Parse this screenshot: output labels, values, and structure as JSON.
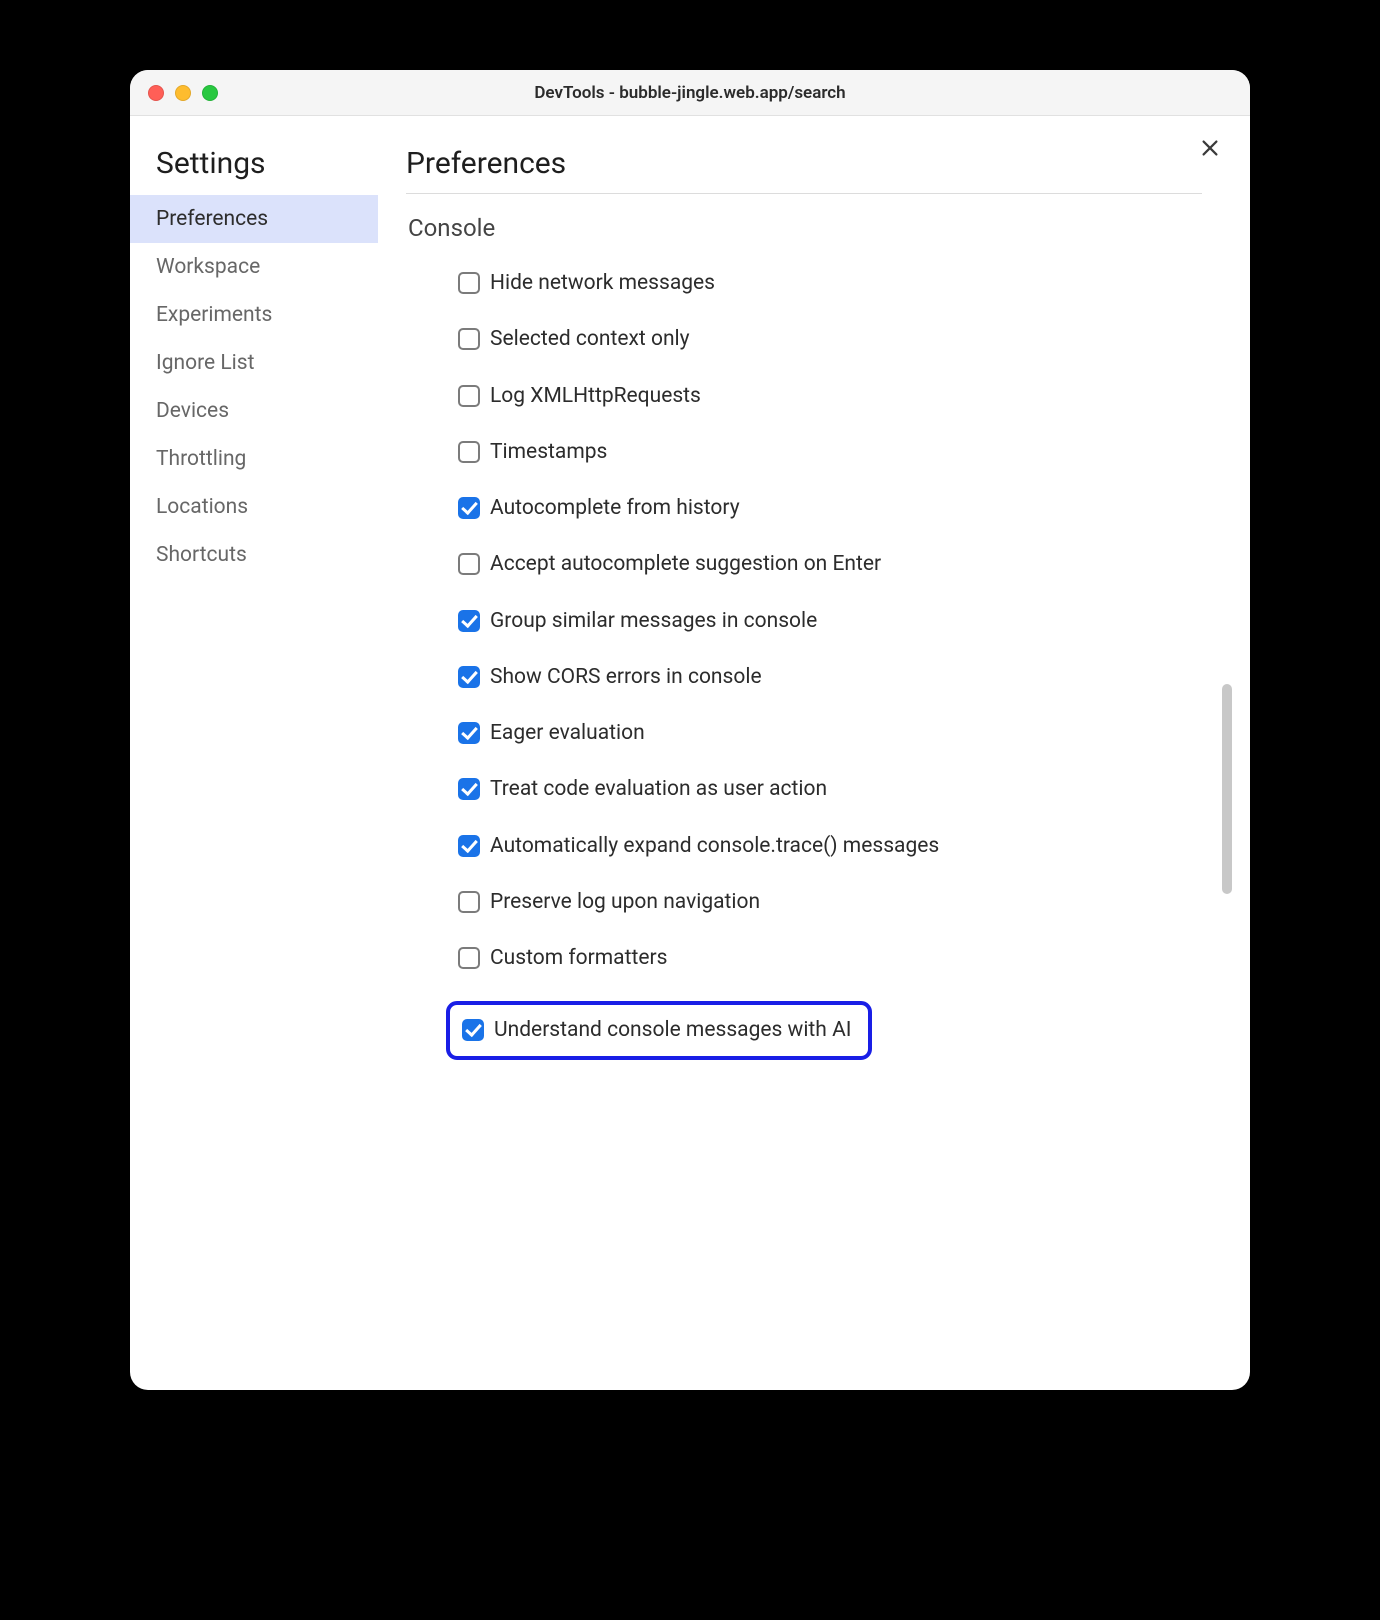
{
  "window_title": "DevTools - bubble-jingle.web.app/search",
  "sidebar": {
    "title": "Settings",
    "items": [
      {
        "label": "Preferences",
        "active": true
      },
      {
        "label": "Workspace",
        "active": false
      },
      {
        "label": "Experiments",
        "active": false
      },
      {
        "label": "Ignore List",
        "active": false
      },
      {
        "label": "Devices",
        "active": false
      },
      {
        "label": "Throttling",
        "active": false
      },
      {
        "label": "Locations",
        "active": false
      },
      {
        "label": "Shortcuts",
        "active": false
      }
    ]
  },
  "main": {
    "title": "Preferences",
    "section": "Console",
    "options": [
      {
        "label": "Hide network messages",
        "checked": false
      },
      {
        "label": "Selected context only",
        "checked": false
      },
      {
        "label": "Log XMLHttpRequests",
        "checked": false
      },
      {
        "label": "Timestamps",
        "checked": false
      },
      {
        "label": "Autocomplete from history",
        "checked": true
      },
      {
        "label": "Accept autocomplete suggestion on Enter",
        "checked": false
      },
      {
        "label": "Group similar messages in console",
        "checked": true
      },
      {
        "label": "Show CORS errors in console",
        "checked": true
      },
      {
        "label": "Eager evaluation",
        "checked": true
      },
      {
        "label": "Treat code evaluation as user action",
        "checked": true
      },
      {
        "label": "Automatically expand console.trace() messages",
        "checked": true
      },
      {
        "label": "Preserve log upon navigation",
        "checked": false
      },
      {
        "label": "Custom formatters",
        "checked": false
      },
      {
        "label": "Understand console messages with AI",
        "checked": true,
        "highlighted": true
      }
    ]
  }
}
